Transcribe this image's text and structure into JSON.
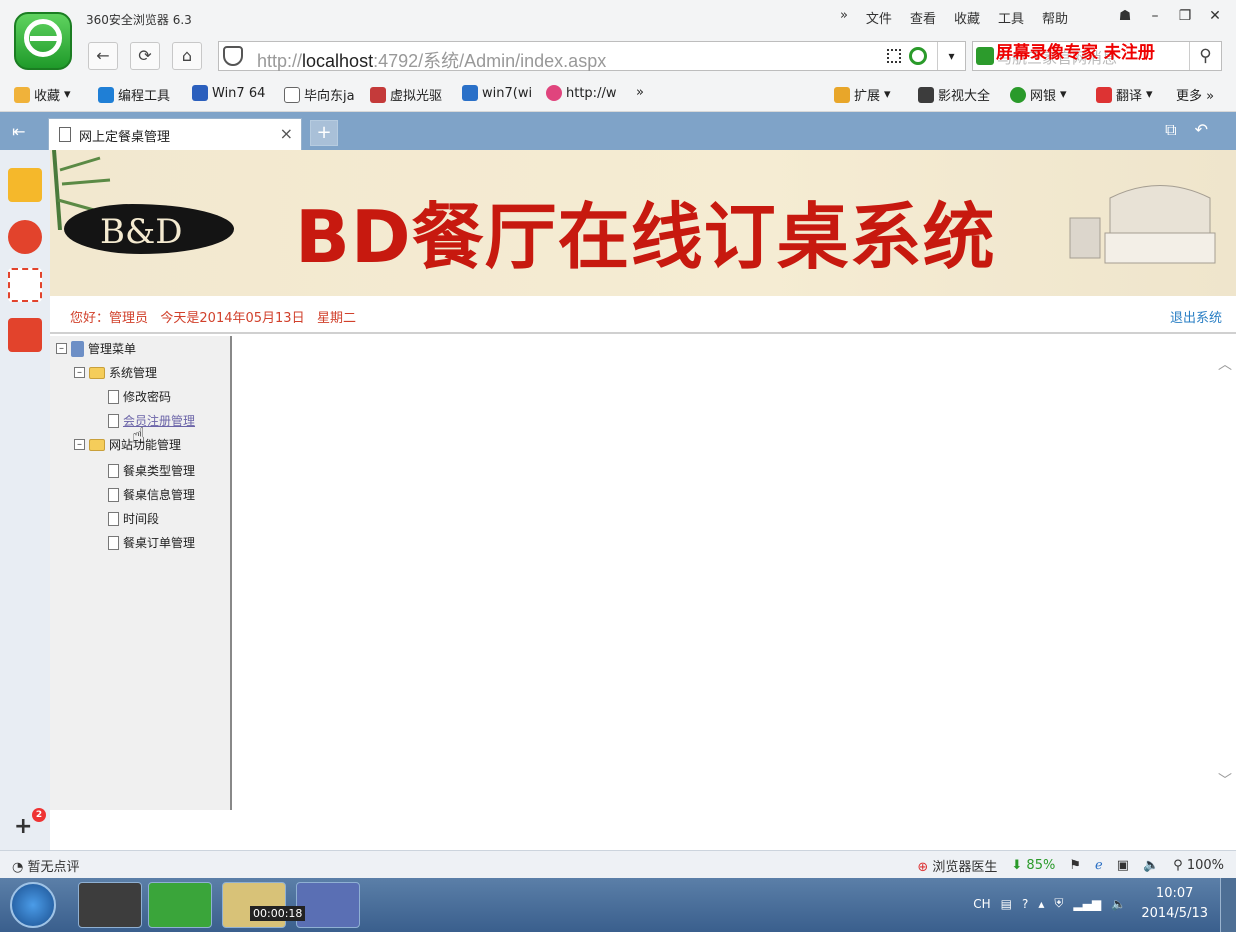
{
  "browser": {
    "window_title": "360安全浏览器 6.3",
    "menu": [
      "»",
      "文件",
      "查看",
      "收藏",
      "工具",
      "帮助"
    ],
    "url_prefix": "http://",
    "url_host": "localhost",
    "url_rest": ":4792/系统/Admin/index.aspx",
    "search_placeholder": "马航三家官网消息",
    "watermark": "屏幕录像专家 未注册",
    "bookmarks": [
      "收藏",
      "编程工具",
      "Win7 64",
      "毕向东ja",
      "虚拟光驱",
      "win7(wi",
      "http://w",
      "»"
    ],
    "bookmarks_right": [
      "扩展",
      "影视大全",
      "网银",
      "翻译",
      "更多 »"
    ],
    "tab_label": "网上定餐桌管理",
    "new_tab": "+"
  },
  "banner": {
    "brand": "B&D",
    "headline": "BD餐厅在线订桌系统"
  },
  "info": {
    "greeting": "您好：管理员   今天是2014年05月13日   星期二",
    "logout": "退出系统"
  },
  "tree": {
    "root": "管理菜单",
    "group1": "系统管理",
    "group1_items": [
      "修改密码",
      "会员注册管理"
    ],
    "group2": "网站功能管理",
    "group2_items": [
      "餐桌类型管理",
      "餐桌信息管理",
      "时间段",
      "餐桌订单管理"
    ]
  },
  "status": {
    "left": "暂无点评",
    "doctor": "浏览器医生",
    "speed": "85%",
    "zoom": "100%"
  },
  "taskbar": {
    "timer": "00:00:18",
    "lang": "CH",
    "time": "10:07",
    "date": "2014/5/13"
  },
  "colors": {
    "headline": "#c7190f",
    "greeting": "#d1412c",
    "logout": "#2a7fc4",
    "tabbar": "#7fa3c8"
  }
}
